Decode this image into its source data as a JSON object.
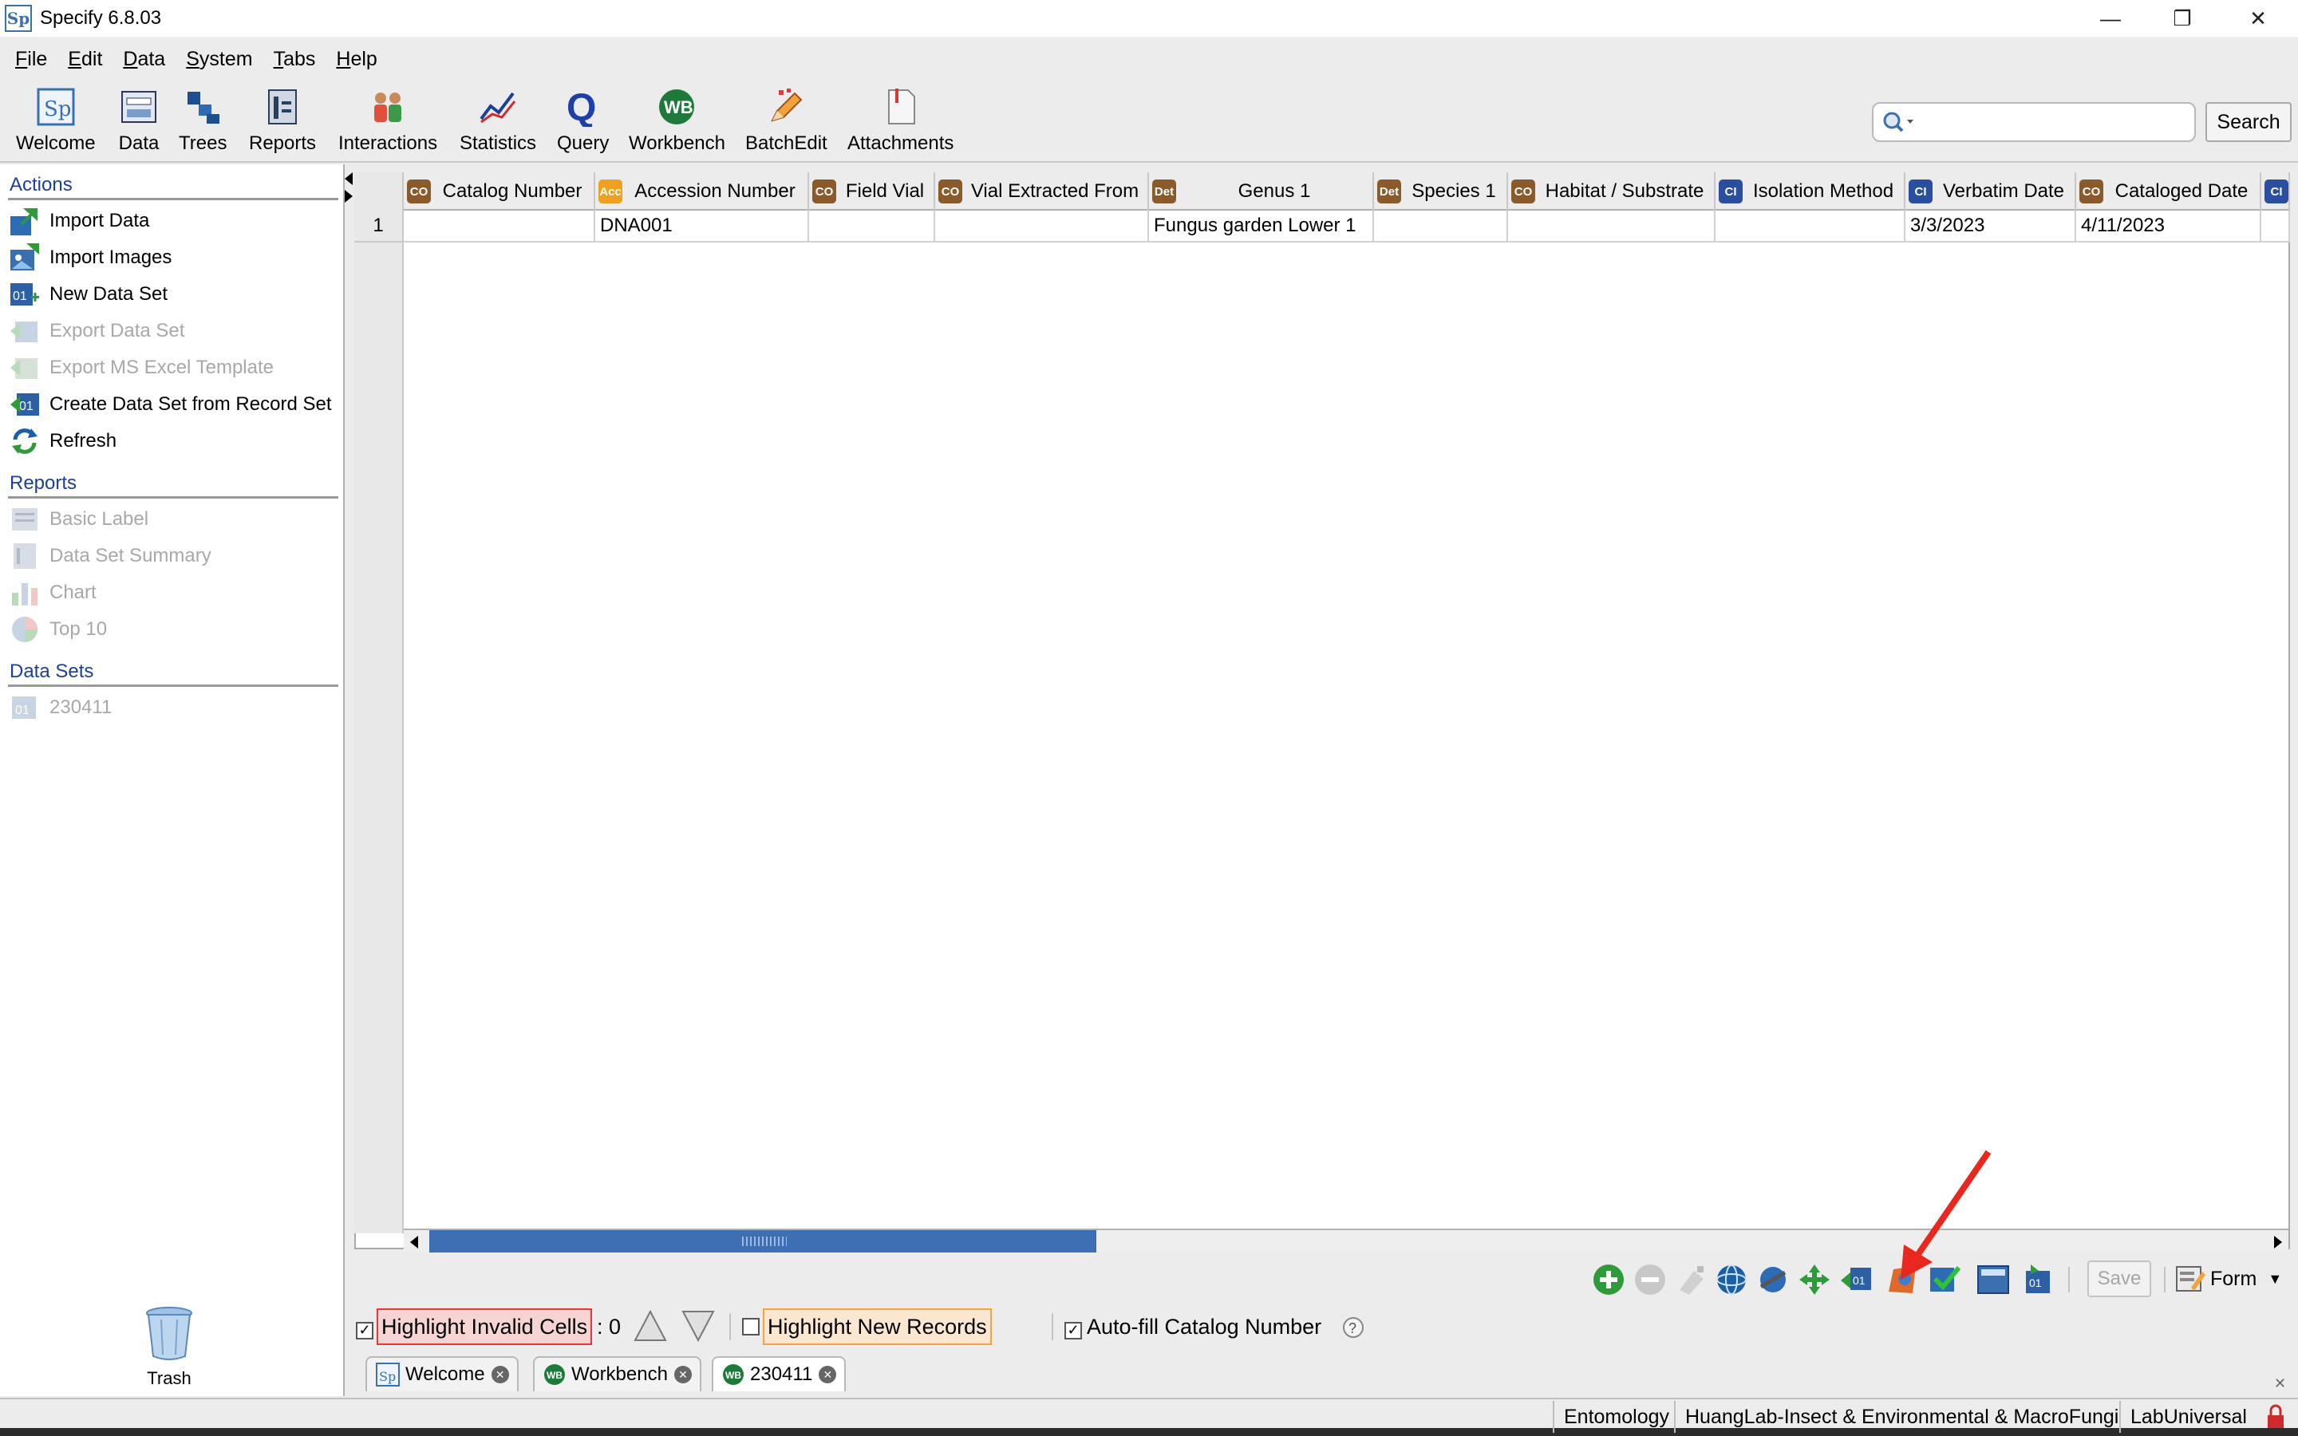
{
  "window": {
    "title": "Specify 6.8.03",
    "logo_text": "Sp"
  },
  "menu": [
    "File",
    "Edit",
    "Data",
    "System",
    "Tabs",
    "Help"
  ],
  "toolbar": {
    "items": [
      "Welcome",
      "Data",
      "Trees",
      "Reports",
      "Interactions",
      "Statistics",
      "Query",
      "Workbench",
      "BatchEdit",
      "Attachments"
    ],
    "search_button": "Search"
  },
  "sidebar": {
    "actions_title": "Actions",
    "actions": [
      "Import Data",
      "Import Images",
      "New Data Set",
      "Export Data Set",
      "Export MS Excel Template",
      "Create Data Set from Record Set",
      "Refresh"
    ],
    "reports_title": "Reports",
    "reports": [
      "Basic Label",
      "Data Set Summary",
      "Chart",
      "Top 10"
    ],
    "datasets_title": "Data Sets",
    "datasets": [
      "230411"
    ],
    "trash_label": "Trash"
  },
  "grid": {
    "columns": [
      {
        "badge": "CO",
        "label": "Catalog Number"
      },
      {
        "badge": "Acc",
        "label": "Accession Number"
      },
      {
        "badge": "CO",
        "label": "Field Vial"
      },
      {
        "badge": "CO",
        "label": "Vial Extracted From"
      },
      {
        "badge": "Det",
        "label": "Genus 1"
      },
      {
        "badge": "Det",
        "label": "Species 1"
      },
      {
        "badge": "CO",
        "label": "Habitat / Substrate"
      },
      {
        "badge": "CI",
        "label": "Isolation Method"
      },
      {
        "badge": "CI",
        "label": "Verbatim Date"
      },
      {
        "badge": "CO",
        "label": "Cataloged Date"
      },
      {
        "badge": "CI",
        "label": ""
      }
    ],
    "rows": [
      {
        "num": "1",
        "cells": [
          "",
          "DNA001",
          "",
          "",
          "Fungus garden Lower 1",
          "",
          "",
          "",
          "3/3/2023",
          "4/11/2023",
          ""
        ]
      }
    ],
    "badge_colors": {
      "CO": "#8b5a2b",
      "Acc": "#f0a020",
      "Det": "#8b5a2b",
      "CI": "#2b4fa0"
    }
  },
  "bottom": {
    "save_label": "Save",
    "form_label": "Form",
    "highlight_invalid_label": "Highlight Invalid Cells",
    "invalid_count": ": 0",
    "highlight_new_label": "Highlight New Records",
    "autofill_label": "Auto-fill Catalog Number"
  },
  "tabs": [
    "Welcome",
    "Workbench",
    "230411"
  ],
  "status": {
    "discipline": "Entomology",
    "collection": "HuangLab-Insect & Environmental & MacroFungi",
    "user": "LabUniversal"
  },
  "colors": {
    "accent": "#3e6fb5",
    "annotation_arrow": "#e8281e"
  }
}
